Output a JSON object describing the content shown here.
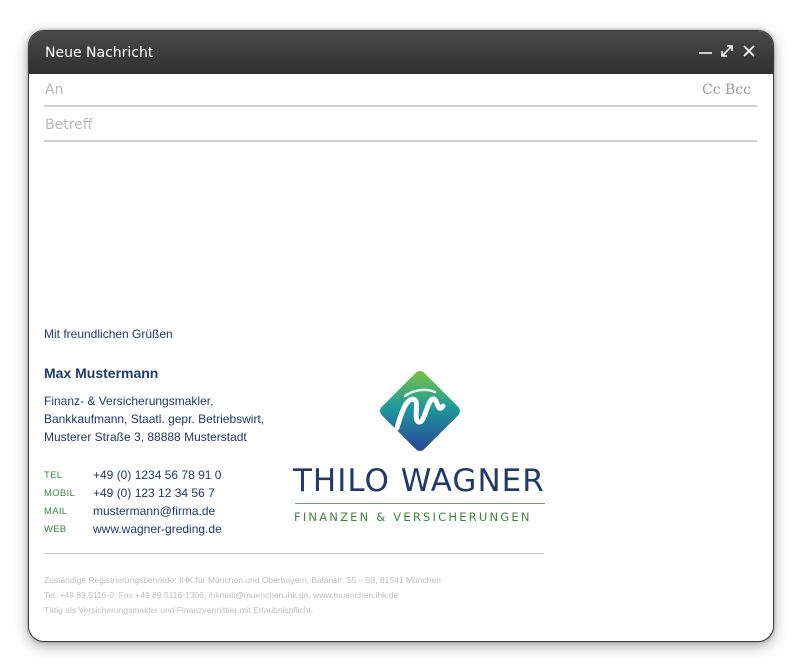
{
  "window": {
    "title": "Neue Nachricht",
    "controls": {
      "minimize_icon": "minimize-icon",
      "expand_icon": "expand-icon",
      "close_icon": "close-icon"
    }
  },
  "compose": {
    "to_placeholder": "An",
    "cc_bcc_label": "Cc Bcc",
    "subject_placeholder": "Betreff"
  },
  "signature": {
    "greeting": "Mit freundlichen Grüßen",
    "name": "Max Mustermann",
    "lines": [
      "Finanz- & Versicherungsmakler,",
      "Bankkaufmann, Staatl. gepr. Betriebswirt,",
      "Musterer Straße 3, 88888 Musterstadt"
    ],
    "contacts": [
      {
        "label": "TEL",
        "value": "+49 (0) 1234 56 78 91 0"
      },
      {
        "label": "MOBIL",
        "value": "+49 (0) 123 12 34 56 7"
      },
      {
        "label": "MAIL",
        "value": "mustermann@firma.de"
      },
      {
        "label": "WEB",
        "value": "www.wagner-greding.de"
      }
    ],
    "footer": [
      "Zuständige Registrierungsbehörde: IHK für München und Oberbayern, Balanstr. 55 – 59, 81541 München",
      "Tel. +49 89 5116-0, Fax +49 89  5116-1306, ihkmail@muenchen.ihk.de, www.muenchen.ihk.de",
      "Tätig als Versicherungsmakler und Finanzvermittler mit Erlaubnispflicht."
    ]
  },
  "logo": {
    "name": "THILO WAGNER",
    "tagline": "FINANZEN & VERSICHERUNGEN",
    "colors": {
      "green": "#6bbf3a",
      "blue": "#2c4fa0",
      "teal": "#1f8fa8",
      "navy": "#1f3a6b"
    }
  },
  "colors": {
    "titlebar": "#3a3a3a",
    "signature_text": "#1f3a6b",
    "label_green": "#3a8a3a",
    "footer_gray": "#c0c0c0"
  }
}
